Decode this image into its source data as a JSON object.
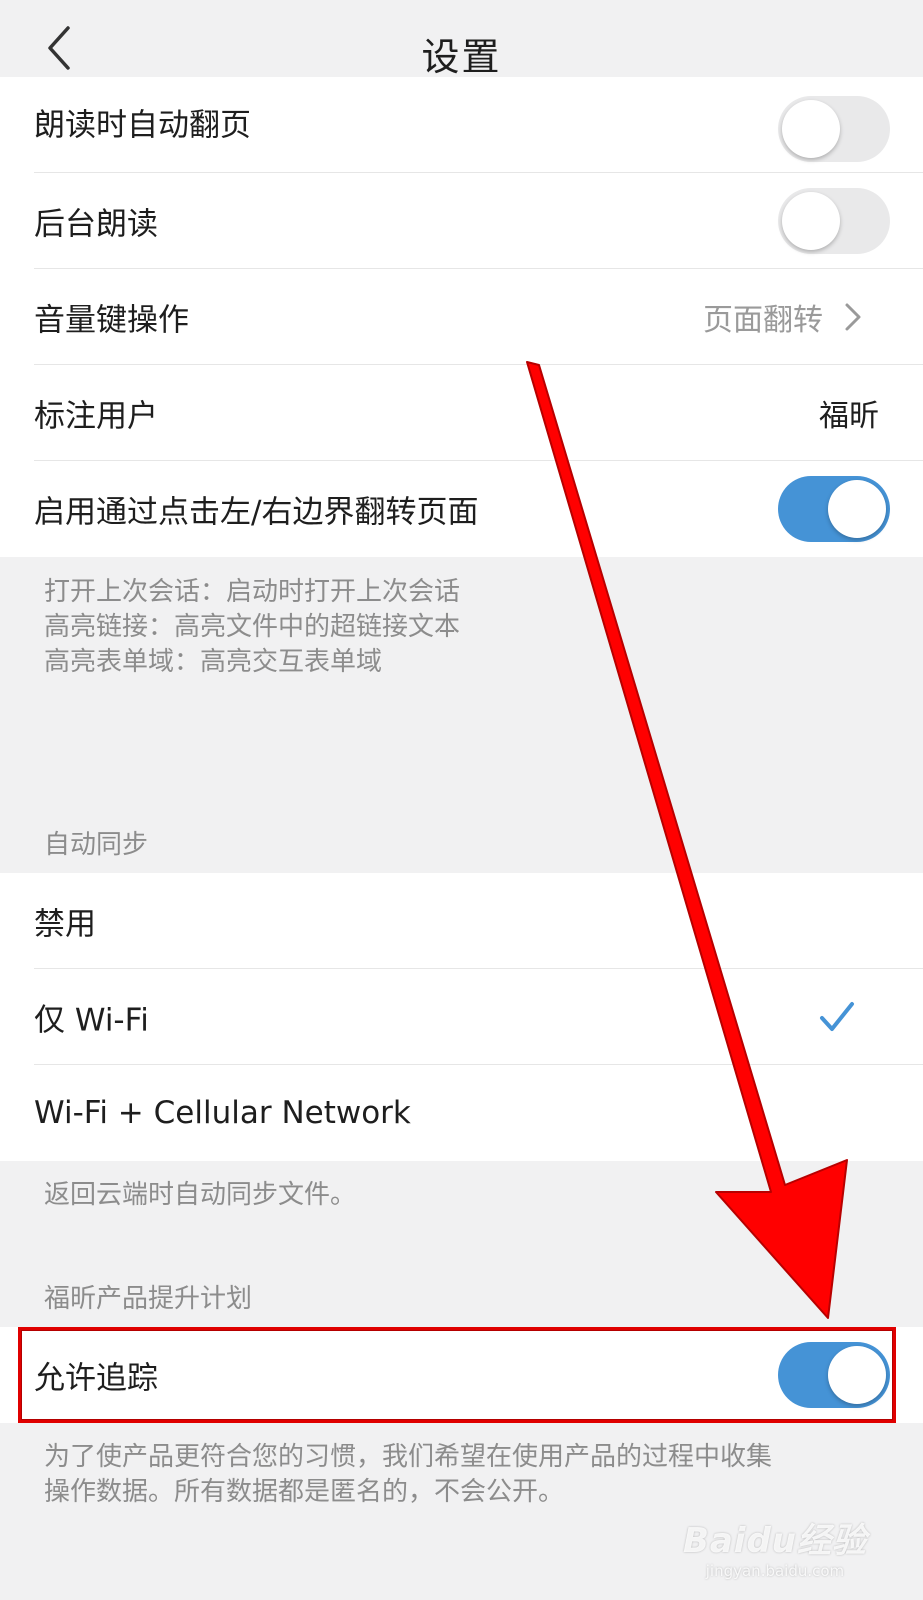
{
  "header": {
    "title": "设置"
  },
  "reading_settings": [
    {
      "label": "朗读时自动翻页",
      "toggle": "off"
    },
    {
      "label": "后台朗读",
      "toggle": "off"
    },
    {
      "label": "音量键操作",
      "value": "页面翻转"
    },
    {
      "label": "标注用户",
      "value": "福昕"
    },
    {
      "label": "启用通过点击左/右边界翻转页面",
      "toggle": "on"
    }
  ],
  "reading_notes": [
    "打开上次会话：启动时打开上次会话",
    "高亮链接：高亮文件中的超链接文本",
    "高亮表单域：高亮交互表单域"
  ],
  "auto_sync": {
    "section_title": "自动同步",
    "options": [
      "禁用",
      "仅 Wi-Fi",
      "Wi-Fi + Cellular Network"
    ],
    "selected": "仅 Wi-Fi",
    "note": "返回云端时自动同步文件。"
  },
  "improvement_plan": {
    "section_title": "福昕产品提升计划",
    "allow_tracking": {
      "label": "允许追踪",
      "toggle": "on"
    },
    "note_line1": "为了使产品更符合您的习惯，我们希望在使用产品的过程中收集",
    "note_line2": "操作数据。所有数据都是匿名的，不会公开。"
  },
  "watermark": {
    "logo": "Baidu经验",
    "url": "jingyan.baidu.com"
  },
  "colors": {
    "toggle_on": "#4593d6",
    "toggle_off": "#e9e9ea",
    "check": "#4593d6",
    "annotation_red": "#ff0000"
  },
  "icons": {
    "back": "chevron-left-icon",
    "disclosure": "chevron-right-icon",
    "selected": "checkmark-icon"
  }
}
